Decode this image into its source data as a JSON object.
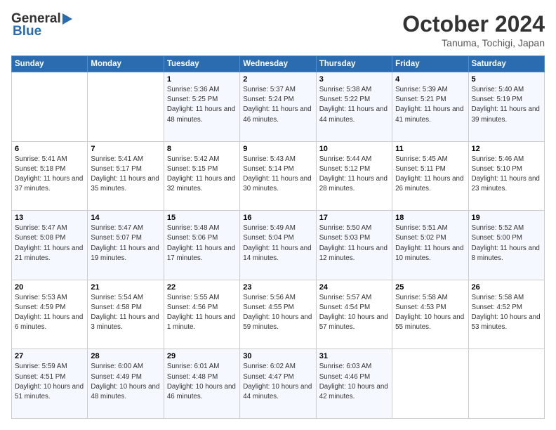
{
  "header": {
    "logo_general": "General",
    "logo_blue": "Blue",
    "month_title": "October 2024",
    "location": "Tanuma, Tochigi, Japan"
  },
  "weekdays": [
    "Sunday",
    "Monday",
    "Tuesday",
    "Wednesday",
    "Thursday",
    "Friday",
    "Saturday"
  ],
  "weeks": [
    [
      {
        "day": "",
        "sunrise": "",
        "sunset": "",
        "daylight": ""
      },
      {
        "day": "",
        "sunrise": "",
        "sunset": "",
        "daylight": ""
      },
      {
        "day": "1",
        "sunrise": "Sunrise: 5:36 AM",
        "sunset": "Sunset: 5:25 PM",
        "daylight": "Daylight: 11 hours and 48 minutes."
      },
      {
        "day": "2",
        "sunrise": "Sunrise: 5:37 AM",
        "sunset": "Sunset: 5:24 PM",
        "daylight": "Daylight: 11 hours and 46 minutes."
      },
      {
        "day": "3",
        "sunrise": "Sunrise: 5:38 AM",
        "sunset": "Sunset: 5:22 PM",
        "daylight": "Daylight: 11 hours and 44 minutes."
      },
      {
        "day": "4",
        "sunrise": "Sunrise: 5:39 AM",
        "sunset": "Sunset: 5:21 PM",
        "daylight": "Daylight: 11 hours and 41 minutes."
      },
      {
        "day": "5",
        "sunrise": "Sunrise: 5:40 AM",
        "sunset": "Sunset: 5:19 PM",
        "daylight": "Daylight: 11 hours and 39 minutes."
      }
    ],
    [
      {
        "day": "6",
        "sunrise": "Sunrise: 5:41 AM",
        "sunset": "Sunset: 5:18 PM",
        "daylight": "Daylight: 11 hours and 37 minutes."
      },
      {
        "day": "7",
        "sunrise": "Sunrise: 5:41 AM",
        "sunset": "Sunset: 5:17 PM",
        "daylight": "Daylight: 11 hours and 35 minutes."
      },
      {
        "day": "8",
        "sunrise": "Sunrise: 5:42 AM",
        "sunset": "Sunset: 5:15 PM",
        "daylight": "Daylight: 11 hours and 32 minutes."
      },
      {
        "day": "9",
        "sunrise": "Sunrise: 5:43 AM",
        "sunset": "Sunset: 5:14 PM",
        "daylight": "Daylight: 11 hours and 30 minutes."
      },
      {
        "day": "10",
        "sunrise": "Sunrise: 5:44 AM",
        "sunset": "Sunset: 5:12 PM",
        "daylight": "Daylight: 11 hours and 28 minutes."
      },
      {
        "day": "11",
        "sunrise": "Sunrise: 5:45 AM",
        "sunset": "Sunset: 5:11 PM",
        "daylight": "Daylight: 11 hours and 26 minutes."
      },
      {
        "day": "12",
        "sunrise": "Sunrise: 5:46 AM",
        "sunset": "Sunset: 5:10 PM",
        "daylight": "Daylight: 11 hours and 23 minutes."
      }
    ],
    [
      {
        "day": "13",
        "sunrise": "Sunrise: 5:47 AM",
        "sunset": "Sunset: 5:08 PM",
        "daylight": "Daylight: 11 hours and 21 minutes."
      },
      {
        "day": "14",
        "sunrise": "Sunrise: 5:47 AM",
        "sunset": "Sunset: 5:07 PM",
        "daylight": "Daylight: 11 hours and 19 minutes."
      },
      {
        "day": "15",
        "sunrise": "Sunrise: 5:48 AM",
        "sunset": "Sunset: 5:06 PM",
        "daylight": "Daylight: 11 hours and 17 minutes."
      },
      {
        "day": "16",
        "sunrise": "Sunrise: 5:49 AM",
        "sunset": "Sunset: 5:04 PM",
        "daylight": "Daylight: 11 hours and 14 minutes."
      },
      {
        "day": "17",
        "sunrise": "Sunrise: 5:50 AM",
        "sunset": "Sunset: 5:03 PM",
        "daylight": "Daylight: 11 hours and 12 minutes."
      },
      {
        "day": "18",
        "sunrise": "Sunrise: 5:51 AM",
        "sunset": "Sunset: 5:02 PM",
        "daylight": "Daylight: 11 hours and 10 minutes."
      },
      {
        "day": "19",
        "sunrise": "Sunrise: 5:52 AM",
        "sunset": "Sunset: 5:00 PM",
        "daylight": "Daylight: 11 hours and 8 minutes."
      }
    ],
    [
      {
        "day": "20",
        "sunrise": "Sunrise: 5:53 AM",
        "sunset": "Sunset: 4:59 PM",
        "daylight": "Daylight: 11 hours and 6 minutes."
      },
      {
        "day": "21",
        "sunrise": "Sunrise: 5:54 AM",
        "sunset": "Sunset: 4:58 PM",
        "daylight": "Daylight: 11 hours and 3 minutes."
      },
      {
        "day": "22",
        "sunrise": "Sunrise: 5:55 AM",
        "sunset": "Sunset: 4:56 PM",
        "daylight": "Daylight: 11 hours and 1 minute."
      },
      {
        "day": "23",
        "sunrise": "Sunrise: 5:56 AM",
        "sunset": "Sunset: 4:55 PM",
        "daylight": "Daylight: 10 hours and 59 minutes."
      },
      {
        "day": "24",
        "sunrise": "Sunrise: 5:57 AM",
        "sunset": "Sunset: 4:54 PM",
        "daylight": "Daylight: 10 hours and 57 minutes."
      },
      {
        "day": "25",
        "sunrise": "Sunrise: 5:58 AM",
        "sunset": "Sunset: 4:53 PM",
        "daylight": "Daylight: 10 hours and 55 minutes."
      },
      {
        "day": "26",
        "sunrise": "Sunrise: 5:58 AM",
        "sunset": "Sunset: 4:52 PM",
        "daylight": "Daylight: 10 hours and 53 minutes."
      }
    ],
    [
      {
        "day": "27",
        "sunrise": "Sunrise: 5:59 AM",
        "sunset": "Sunset: 4:51 PM",
        "daylight": "Daylight: 10 hours and 51 minutes."
      },
      {
        "day": "28",
        "sunrise": "Sunrise: 6:00 AM",
        "sunset": "Sunset: 4:49 PM",
        "daylight": "Daylight: 10 hours and 48 minutes."
      },
      {
        "day": "29",
        "sunrise": "Sunrise: 6:01 AM",
        "sunset": "Sunset: 4:48 PM",
        "daylight": "Daylight: 10 hours and 46 minutes."
      },
      {
        "day": "30",
        "sunrise": "Sunrise: 6:02 AM",
        "sunset": "Sunset: 4:47 PM",
        "daylight": "Daylight: 10 hours and 44 minutes."
      },
      {
        "day": "31",
        "sunrise": "Sunrise: 6:03 AM",
        "sunset": "Sunset: 4:46 PM",
        "daylight": "Daylight: 10 hours and 42 minutes."
      },
      {
        "day": "",
        "sunrise": "",
        "sunset": "",
        "daylight": ""
      },
      {
        "day": "",
        "sunrise": "",
        "sunset": "",
        "daylight": ""
      }
    ]
  ]
}
